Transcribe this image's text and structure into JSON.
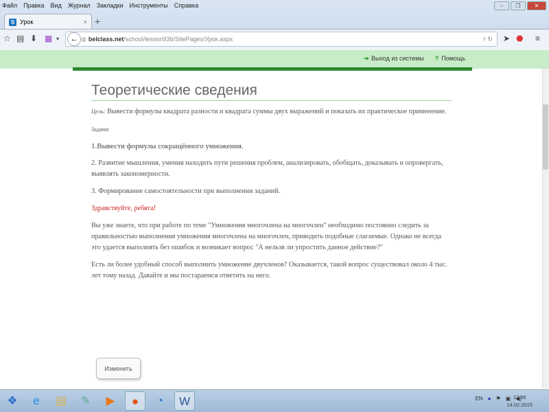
{
  "browser": {
    "menu": [
      "Файл",
      "Правка",
      "Вид",
      "Журнал",
      "Закладки",
      "Инструменты",
      "Справка"
    ],
    "tab_title": "Урок",
    "url_host": "belclass.net",
    "url_path": "/school/lesson936/SitePages/Урок.aspx"
  },
  "site": {
    "logout": "Выход из системы",
    "help": "Помощь"
  },
  "page": {
    "title": "Теоретические сведения",
    "goal_label": "Цель:",
    "goal_text": "Вывести формулы  квадрата разности и квадрата суммы двух выражений и показать их практическое применение.",
    "tasks_label": "Задачи:",
    "task1": "1.Вывести формулы сокращённого умножения.",
    "task2": "2. Развитие мышления, умения находить пути решения проблем, анализировать, обобщать,  доказывать и опровергать, выявлять закономерности.",
    "task3": "3. Формирование самостоятельности при выполнении заданий.",
    "greeting": "Здравствуйте, ребята!",
    "para1": "Вы уже знаете, что при работе по теме \"Умножения многочлена на многочлен\" необходимо постоянно следить за правильностью выполнения умножения многочлена на многочлен, приводить подобные слагаемые. Однако не всегда это удается выполнять без ошибок и возникает вопрос \"А нельзя ли упростить данное действие?\"",
    "para2": "Есть ли более удобный способ выполнить умножение  двучленов? Оказывается, такой вопрос существовал около 4 тыс. лет тому назад. Давайте и мы постараемся ответить на него.",
    "edit_button": "Изменить"
  },
  "taskbar": {
    "lang": "EN",
    "time": "12:06",
    "date": "14.02.2015"
  }
}
